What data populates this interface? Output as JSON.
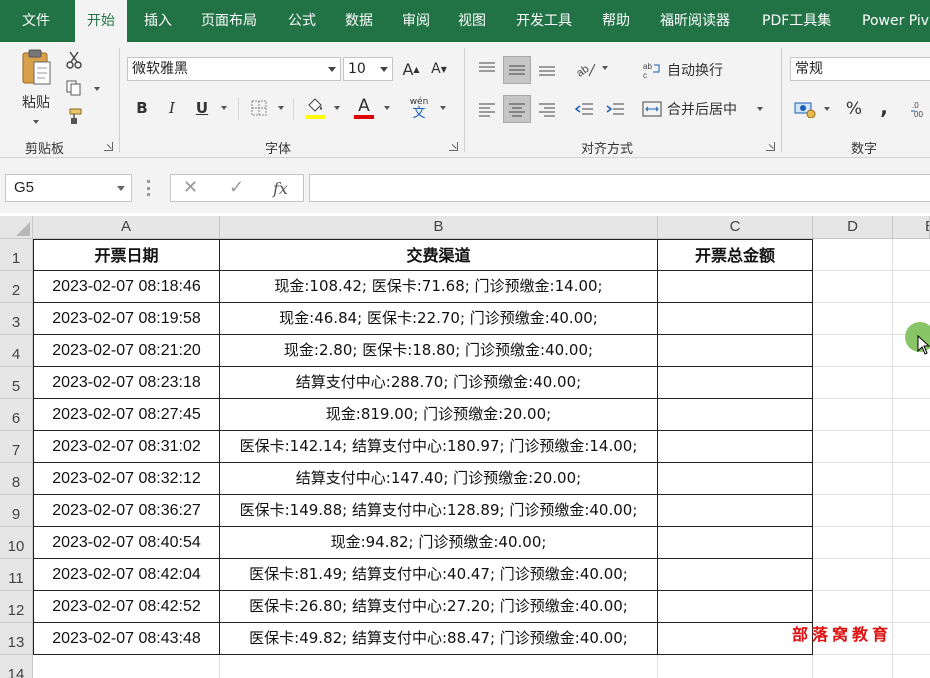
{
  "menu": {
    "tabs": [
      "文件",
      "开始",
      "插入",
      "页面布局",
      "公式",
      "数据",
      "审阅",
      "视图",
      "开发工具",
      "帮助",
      "福昕阅读器",
      "PDF工具集",
      "Power Piv"
    ],
    "active": "开始"
  },
  "ribbon": {
    "clipboard": {
      "paste": "粘贴",
      "label": "剪贴板"
    },
    "font": {
      "name": "微软雅黑",
      "size": "10",
      "label": "字体",
      "bold": "B",
      "italic": "I",
      "underline": "U",
      "grow": "A",
      "shrink": "A",
      "font_color_letter": "A",
      "phonetic_top": "wén",
      "phonetic_bottom": "文"
    },
    "alignment": {
      "wrap": "自动换行",
      "merge": "合并后居中",
      "label": "对齐方式"
    },
    "number": {
      "format": "常规",
      "label": "数字",
      "percent": "%",
      "comma": ","
    },
    "colors": {
      "accent": "#217346",
      "fill_highlight": "#ffff00",
      "font_red": "#e00000"
    }
  },
  "formula_bar": {
    "name_box": "G5",
    "cancel": "✕",
    "enter": "✓",
    "fx": "fx",
    "formula": ""
  },
  "sheet": {
    "columns": [
      "A",
      "B",
      "C",
      "D",
      "E"
    ],
    "rows": [
      "1",
      "2",
      "3",
      "4",
      "5",
      "6",
      "7",
      "8",
      "9",
      "10",
      "11",
      "12",
      "13",
      "14"
    ],
    "headers": [
      "开票日期",
      "交费渠道",
      "开票总金额"
    ],
    "data": [
      [
        "2023-02-07 08:18:46",
        "现金:108.42; 医保卡:71.68; 门诊预缴金:14.00;",
        ""
      ],
      [
        "2023-02-07 08:19:58",
        "现金:46.84; 医保卡:22.70; 门诊预缴金:40.00;",
        ""
      ],
      [
        "2023-02-07 08:21:20",
        "现金:2.80; 医保卡:18.80; 门诊预缴金:40.00;",
        ""
      ],
      [
        "2023-02-07 08:23:18",
        "结算支付中心:288.70; 门诊预缴金:40.00;",
        ""
      ],
      [
        "2023-02-07 08:27:45",
        "现金:819.00; 门诊预缴金:20.00;",
        ""
      ],
      [
        "2023-02-07 08:31:02",
        "医保卡:142.14; 结算支付中心:180.97; 门诊预缴金:14.00;",
        ""
      ],
      [
        "2023-02-07 08:32:12",
        "结算支付中心:147.40; 门诊预缴金:20.00;",
        ""
      ],
      [
        "2023-02-07 08:36:27",
        "医保卡:149.88; 结算支付中心:128.89; 门诊预缴金:40.00;",
        ""
      ],
      [
        "2023-02-07 08:40:54",
        "现金:94.82; 门诊预缴金:40.00;",
        ""
      ],
      [
        "2023-02-07 08:42:04",
        "医保卡:81.49; 结算支付中心:40.47; 门诊预缴金:40.00;",
        ""
      ],
      [
        "2023-02-07 08:42:52",
        "医保卡:26.80; 结算支付中心:27.20; 门诊预缴金:40.00;",
        ""
      ],
      [
        "2023-02-07 08:43:48",
        "医保卡:49.82; 结算支付中心:88.47; 门诊预缴金:40.00;",
        ""
      ]
    ]
  },
  "watermark": "部落窝教育"
}
